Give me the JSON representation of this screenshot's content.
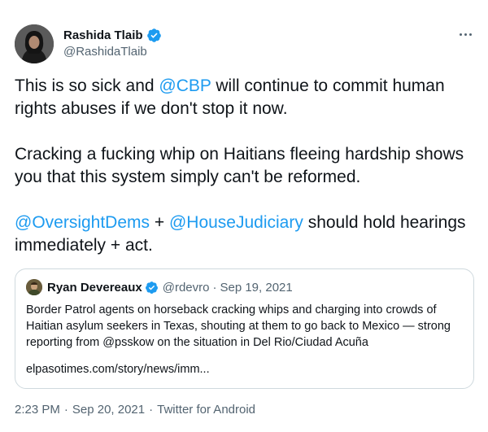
{
  "author": {
    "name": "Rashida Tlaib",
    "handle": "@RashidaTlaib",
    "verified": true
  },
  "tweet": {
    "line1": {
      "before": "This is so sick and ",
      "mention": "@CBP",
      "after": " will continue to commit human rights abuses if we don't stop it now."
    },
    "line2": "Cracking a fucking whip on Haitians fleeing hardship shows you that this system simply can't be reformed.",
    "line3": {
      "mention1": "@OversightDems",
      "middle": " + ",
      "mention2": "@HouseJudiciary",
      "after": " should hold hearings immediately + act."
    }
  },
  "quote": {
    "name": "Ryan Devereaux",
    "verified": true,
    "handle": "@rdevro",
    "separator": "·",
    "date": "Sep 19, 2021",
    "text": "Border Patrol agents on horseback cracking whips and charging into crowds of Haitian asylum seekers in Texas, shouting at them to go back to Mexico — strong reporting from @psskow on the situation in Del Rio/Ciudad Acuña",
    "link": "elpasotimes.com/story/news/imm..."
  },
  "meta": {
    "time": "2:23 PM",
    "separator": "·",
    "date": "Sep 20, 2021",
    "separator2": "·",
    "source": "Twitter for Android"
  },
  "colors": {
    "accent": "#1d9bf0",
    "text": "#0f1419",
    "secondary": "#536471",
    "border": "#cfd9de"
  },
  "icons": {
    "verified": "verified-badge-icon",
    "more": "more-options-icon"
  }
}
